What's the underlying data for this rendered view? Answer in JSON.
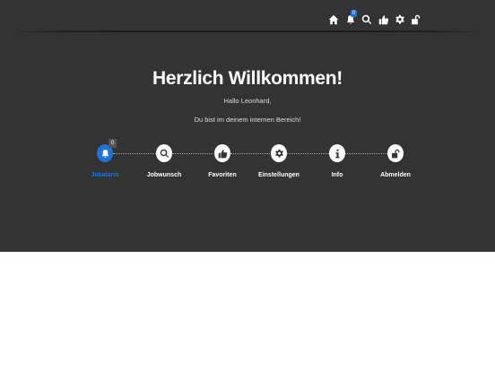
{
  "nav": {
    "icons": [
      "home-icon",
      "bell-icon",
      "search-icon",
      "thumbs-up-icon",
      "gear-icon",
      "unlock-icon"
    ],
    "notification_count": "0"
  },
  "hero": {
    "title": "Herzlich Willkommen!",
    "greeting": "Hallo Leonhard,",
    "subtitle": "Du bist im deinem internen Bereich!"
  },
  "steps": {
    "items": [
      {
        "label": "Jobalarm",
        "icon": "bell-icon",
        "active": true,
        "badge": "0"
      },
      {
        "label": "Jobwunsch",
        "icon": "search-icon",
        "active": false
      },
      {
        "label": "Favoriten",
        "icon": "thumbs-up-icon",
        "active": false
      },
      {
        "label": "Einstellungen",
        "icon": "gear-icon",
        "active": false
      },
      {
        "label": "Info",
        "icon": "info-icon",
        "active": false
      },
      {
        "label": "Abmelden",
        "icon": "unlock-icon",
        "active": false
      }
    ]
  },
  "colors": {
    "background": "#333333",
    "accent": "#1e73d8",
    "text": "#ffffff"
  }
}
